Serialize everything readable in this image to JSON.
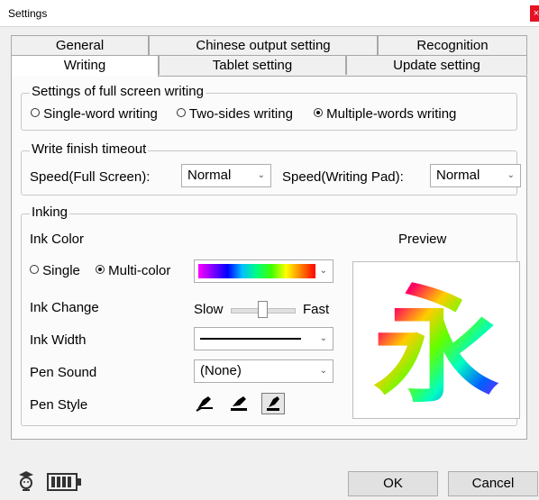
{
  "window": {
    "title": "Settings",
    "close": "×"
  },
  "tabs_top": [
    "General",
    "Chinese output setting",
    "Recognition"
  ],
  "tabs_bottom": [
    "Writing",
    "Tablet setting",
    "Update setting"
  ],
  "fullscreen": {
    "legend": "Settings of full screen writing",
    "options": [
      "Single-word writing",
      "Two-sides writing",
      "Multiple-words writing"
    ],
    "selected": "Multiple-words writing"
  },
  "timeout": {
    "legend": "Write finish timeout",
    "full_label": "Speed(Full Screen):",
    "full_value": "Normal",
    "pad_label": "Speed(Writing Pad):",
    "pad_value": "Normal"
  },
  "inking": {
    "legend": "Inking",
    "ink_color": "Ink Color",
    "preview": "Preview",
    "single": "Single",
    "multi": "Multi-color",
    "selected_mode": "Multi-color",
    "ink_change": "Ink Change",
    "slow": "Slow",
    "fast": "Fast",
    "slider_value": 0.5,
    "ink_width": "Ink Width",
    "pen_sound": "Pen Sound",
    "pen_sound_value": "(None)",
    "pen_style": "Pen Style",
    "preview_char": "永"
  },
  "footer": {
    "ok": "OK",
    "cancel": "Cancel"
  }
}
